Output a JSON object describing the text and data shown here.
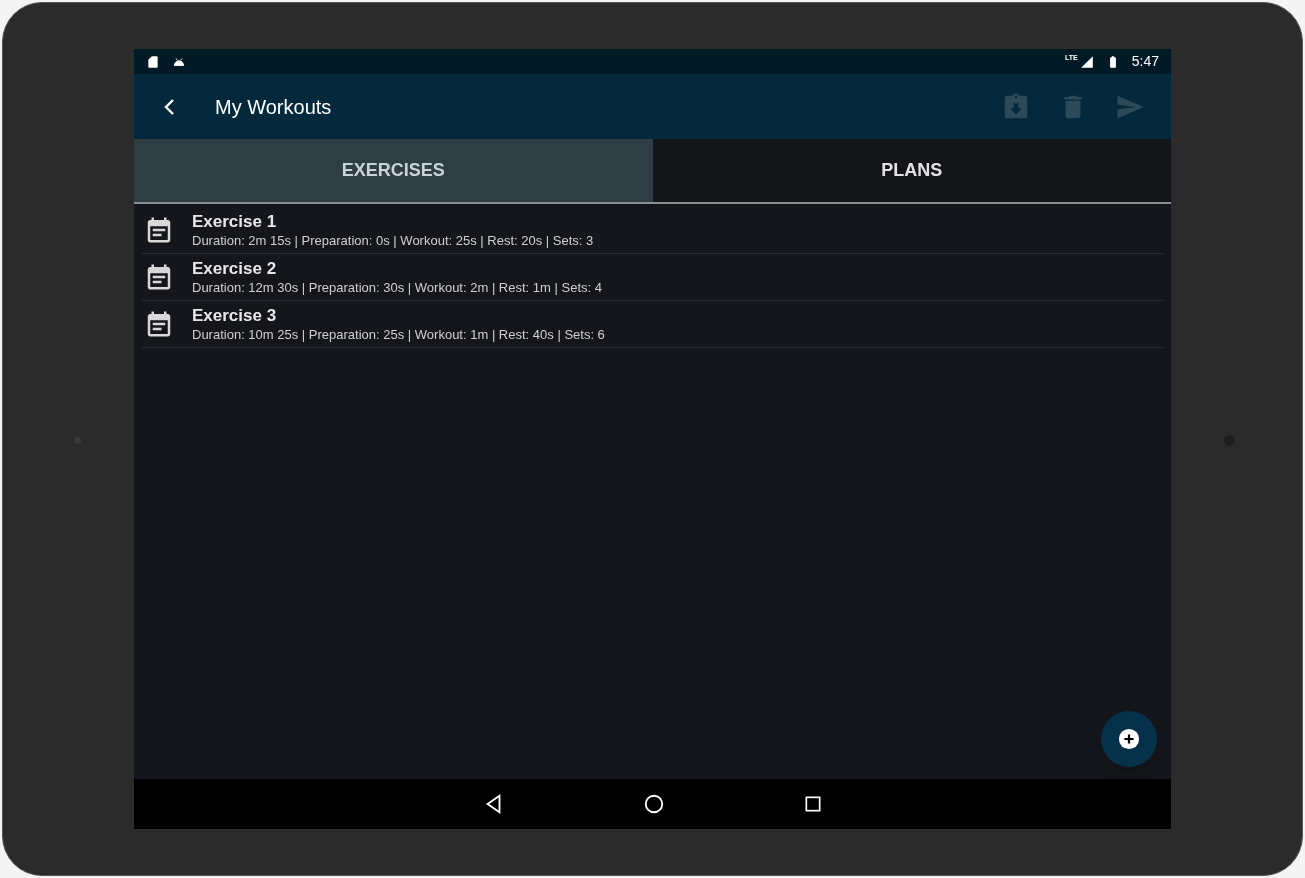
{
  "status_bar": {
    "time": "5:47",
    "network": "LTE"
  },
  "app_bar": {
    "title": "My Workouts",
    "actions": [
      {
        "kind": "download",
        "disabled": true
      },
      {
        "kind": "delete",
        "disabled": true
      },
      {
        "kind": "send",
        "disabled": true
      }
    ]
  },
  "tabs": [
    {
      "label": "EXERCISES",
      "selected": true
    },
    {
      "label": "PLANS",
      "selected": false
    }
  ],
  "exercises": [
    {
      "name": "Exercise 1",
      "details": "Duration: 2m 15s | Preparation: 0s | Workout: 25s | Rest: 20s | Sets: 3"
    },
    {
      "name": "Exercise 2",
      "details": "Duration: 12m 30s | Preparation: 30s | Workout: 2m | Rest: 1m | Sets: 4"
    },
    {
      "name": "Exercise 3",
      "details": "Duration: 10m 25s | Preparation: 25s | Workout: 1m | Rest: 40s | Sets: 6"
    }
  ]
}
